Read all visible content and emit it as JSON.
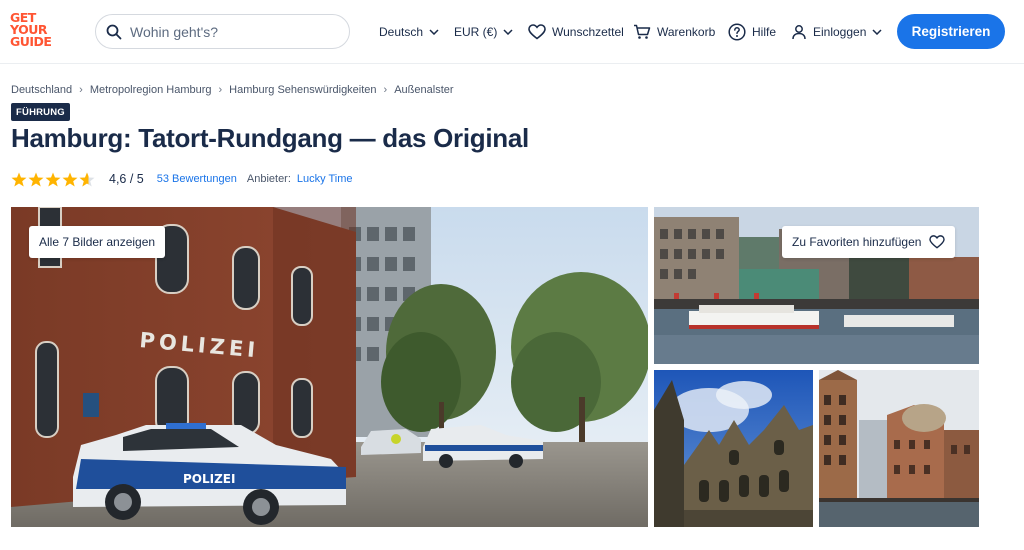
{
  "header": {
    "logo_lines": [
      "GET",
      "YOUR",
      "GUIDE"
    ],
    "search_placeholder": "Wohin geht's?",
    "language": "Deutsch",
    "currency": "EUR (€)",
    "wishlist": "Wunschzettel",
    "cart": "Warenkorb",
    "help": "Hilfe",
    "login": "Einloggen",
    "register": "Registrieren"
  },
  "breadcrumb": [
    "Deutschland",
    "Metropolregion Hamburg",
    "Hamburg Sehenswürdigkeiten",
    "Außenalster"
  ],
  "badge": "FÜHRUNG",
  "title": "Hamburg: Tatort-Rundgang — das Original",
  "rating": {
    "value": "4,6 / 5",
    "stars": 4.6,
    "reviews": "53 Bewertungen",
    "provider_label": "Anbieter:",
    "provider": "Lucky Time"
  },
  "gallery": {
    "show_all": "Alle 7 Bilder anzeigen",
    "favorite": "Zu Favoriten hinzufügen",
    "police_sign": "POLIZEI",
    "car_text": "POLIZEI"
  },
  "colors": {
    "brand": "#ff5533",
    "primary": "#1a74e8",
    "text": "#1a2b49",
    "star": "#ffb400"
  }
}
